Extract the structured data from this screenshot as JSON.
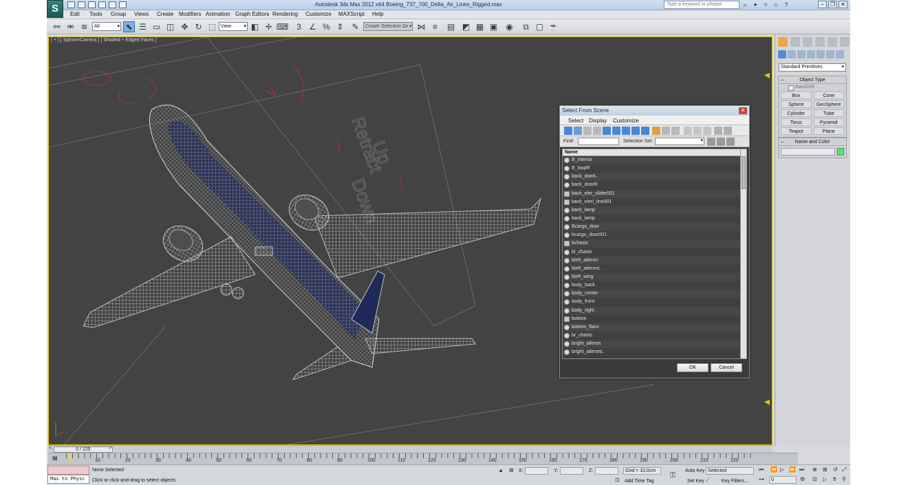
{
  "window": {
    "app_logo": "S",
    "title": "Autodesk 3ds Max  2012 x64     Boeing_737_700_Delta_Air_Lines_Rigged.max",
    "search_placeholder": "Type a keyword or phrase"
  },
  "menu": [
    "Edit",
    "Tools",
    "Group",
    "Views",
    "Create",
    "Modifiers",
    "Animation",
    "Graph Editors",
    "Rendering",
    "Customize",
    "MAXScript",
    "Help"
  ],
  "toolbar": {
    "filter_value": "All",
    "coord_value": "View",
    "selection_set": "Create Selection Se"
  },
  "viewport": {
    "label": "[ + ] [ SpinnerCamera ] [ Shaded + Edged Faces ]"
  },
  "command_panel": {
    "category_value": "Standard Primitives",
    "object_type_title": "Object Type",
    "autogrid_label": "AutoGrid",
    "primitives": [
      "Box",
      "Cone",
      "Sphere",
      "GeoSphere",
      "Cylinder",
      "Tube",
      "Torus",
      "Pyramid",
      "Teapot",
      "Plane"
    ],
    "name_color_title": "Name and Color",
    "object_color": "#5ee07a"
  },
  "timeline": {
    "position": "0 / 225",
    "ticks": [
      "10",
      "20",
      "30",
      "40",
      "50",
      "60",
      "70",
      "80",
      "90",
      "100",
      "110",
      "120",
      "130",
      "140",
      "150",
      "160",
      "170",
      "180",
      "190",
      "200",
      "210",
      "220"
    ]
  },
  "status": {
    "maxscript_label": "Max to Physc",
    "selection": "None Selected",
    "prompt": "Click or click-and-drag to select objects",
    "x_label": "X:",
    "y_label": "Y:",
    "z_label": "Z:",
    "grid": "Grid = 10,0cm",
    "add_time_tag": "Add Time Tag",
    "auto_key": "Auto Key",
    "selected_value": "Selected",
    "set_key": "Set Key",
    "key_filters": "Key Filters...",
    "frame_value": "0"
  },
  "dialog": {
    "title": "Select From Scene",
    "menu": [
      "Select",
      "Display",
      "Customize"
    ],
    "find_label": "Find:",
    "selection_set_label": "Selection Set:",
    "column_header": "Name",
    "items": [
      {
        "name": "B_interior",
        "kind": "object"
      },
      {
        "name": "B_loopR",
        "kind": "object"
      },
      {
        "name": "back_doorL",
        "kind": "object"
      },
      {
        "name": "back_doorR",
        "kind": "object"
      },
      {
        "name": "back_eler_slider001",
        "kind": "group"
      },
      {
        "name": "back_elerl_line001",
        "kind": "group"
      },
      {
        "name": "back_lamp",
        "kind": "object"
      },
      {
        "name": "back_lamp",
        "kind": "object"
      },
      {
        "name": "Bcargo_door",
        "kind": "object"
      },
      {
        "name": "bcargo_door001",
        "kind": "object"
      },
      {
        "name": "bchasis",
        "kind": "group"
      },
      {
        "name": "bl_chasis",
        "kind": "object"
      },
      {
        "name": "bleft_aileron",
        "kind": "object"
      },
      {
        "name": "bleft_aileronL",
        "kind": "object"
      },
      {
        "name": "bleft_wing",
        "kind": "object"
      },
      {
        "name": "body_back",
        "kind": "object"
      },
      {
        "name": "body_center",
        "kind": "object"
      },
      {
        "name": "body_front",
        "kind": "object"
      },
      {
        "name": "body_right",
        "kind": "object"
      },
      {
        "name": "bottom",
        "kind": "group"
      },
      {
        "name": "bottom_flanc",
        "kind": "object"
      },
      {
        "name": "br_chasis",
        "kind": "object"
      },
      {
        "name": "bright_aileron",
        "kind": "object"
      },
      {
        "name": "bright_aileronL",
        "kind": "object"
      }
    ],
    "ok_label": "OK",
    "cancel_label": "Cancel"
  },
  "colors": {
    "viewport_bg": "#434343",
    "viewport_border": "#e5c400",
    "wireframe": "#b9b9b9",
    "fuselage_inner": "#1f2a5a",
    "splines": "#b83030"
  }
}
